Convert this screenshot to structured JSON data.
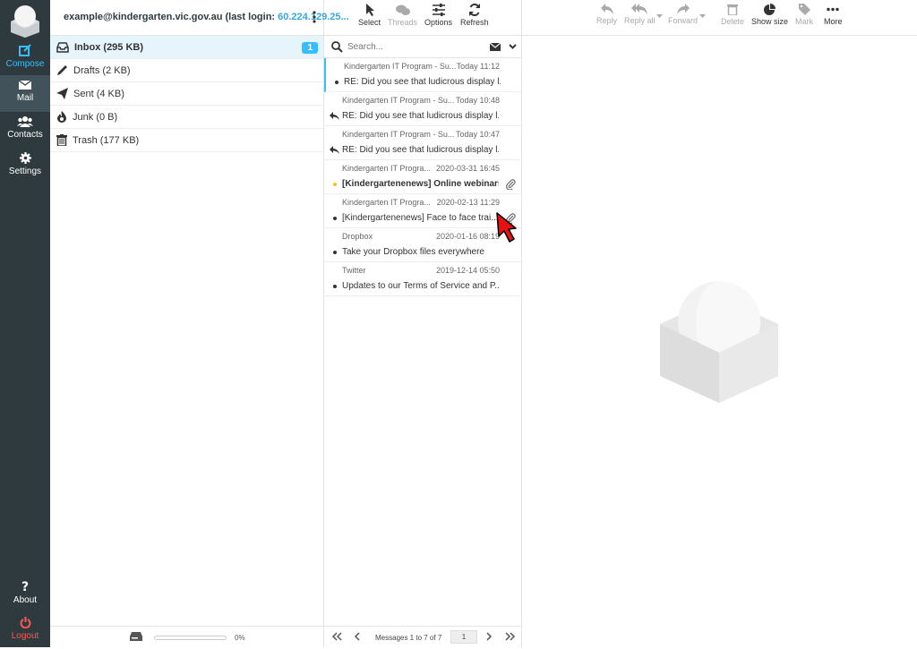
{
  "nav": {
    "compose": "Compose",
    "mail": "Mail",
    "contacts": "Contacts",
    "settings": "Settings",
    "about": "About",
    "logout": "Logout"
  },
  "account": {
    "email": "example@kindergarten.vic.gov.au (last login: ",
    "ip": "60.224.129.25..."
  },
  "folders": [
    {
      "label": "Inbox",
      "size": "(295 KB)",
      "unread": "1",
      "icon": "inbox-icon"
    },
    {
      "label": "Drafts",
      "size": "(2 KB)",
      "icon": "pencil-icon"
    },
    {
      "label": "Sent",
      "size": "(4 KB)",
      "icon": "paper-plane-icon"
    },
    {
      "label": "Junk",
      "size": "(0 B)",
      "icon": "fire-icon"
    },
    {
      "label": "Trash",
      "size": "(177 KB)",
      "icon": "trash-icon"
    }
  ],
  "quota": {
    "percent": "0%",
    "fill": 0
  },
  "list_toolbar": {
    "select": "Select",
    "threads": "Threads",
    "options": "Options",
    "refresh": "Refresh"
  },
  "search": {
    "placeholder": "Search..."
  },
  "messages": [
    {
      "from": "Kindergarten IT Program - Su...",
      "date": "Today 11:12",
      "subject": "RE: Did you see that ludicrous display l...",
      "marker": "dot"
    },
    {
      "from": "Kindergarten IT Program - Su...",
      "date": "Today 10:48",
      "subject": "RE: Did you see that ludicrous display l...",
      "marker": "replied"
    },
    {
      "from": "Kindergarten IT Program - Su...",
      "date": "Today 10:47",
      "subject": "RE: Did you see that ludicrous display l...",
      "marker": "replied"
    },
    {
      "from": "Kindergarten IT Progra...",
      "date": "2020-03-31 16:45",
      "subject": "[Kindergartenenews] Online webinars...",
      "marker": "flag",
      "unread": true,
      "attachment": true
    },
    {
      "from": "Kindergarten IT Progra...",
      "date": "2020-02-13 11:29",
      "subject": "[Kindergartenenews] Face to face trai...",
      "marker": "dot",
      "attachment": true
    },
    {
      "from": "Dropbox",
      "date": "2020-01-16 08:19",
      "subject": "Take your Dropbox files everywhere",
      "marker": "dot"
    },
    {
      "from": "Twitter",
      "date": "2019-12-14 05:50",
      "subject": "Updates to our Terms of Service and P...",
      "marker": "dot"
    }
  ],
  "pager": {
    "count": "Messages 1 to 7 of 7",
    "page": "1"
  },
  "content_toolbar": {
    "reply": "Reply",
    "reply_all": "Reply all",
    "forward": "Forward",
    "delete": "Delete",
    "show_size": "Show size",
    "mark": "Mark",
    "more": "More"
  },
  "colors": {
    "accent": "#37beff",
    "nav_bg": "#2f3a3f",
    "logout": "#ff5552",
    "flag": "#f4c21f"
  }
}
